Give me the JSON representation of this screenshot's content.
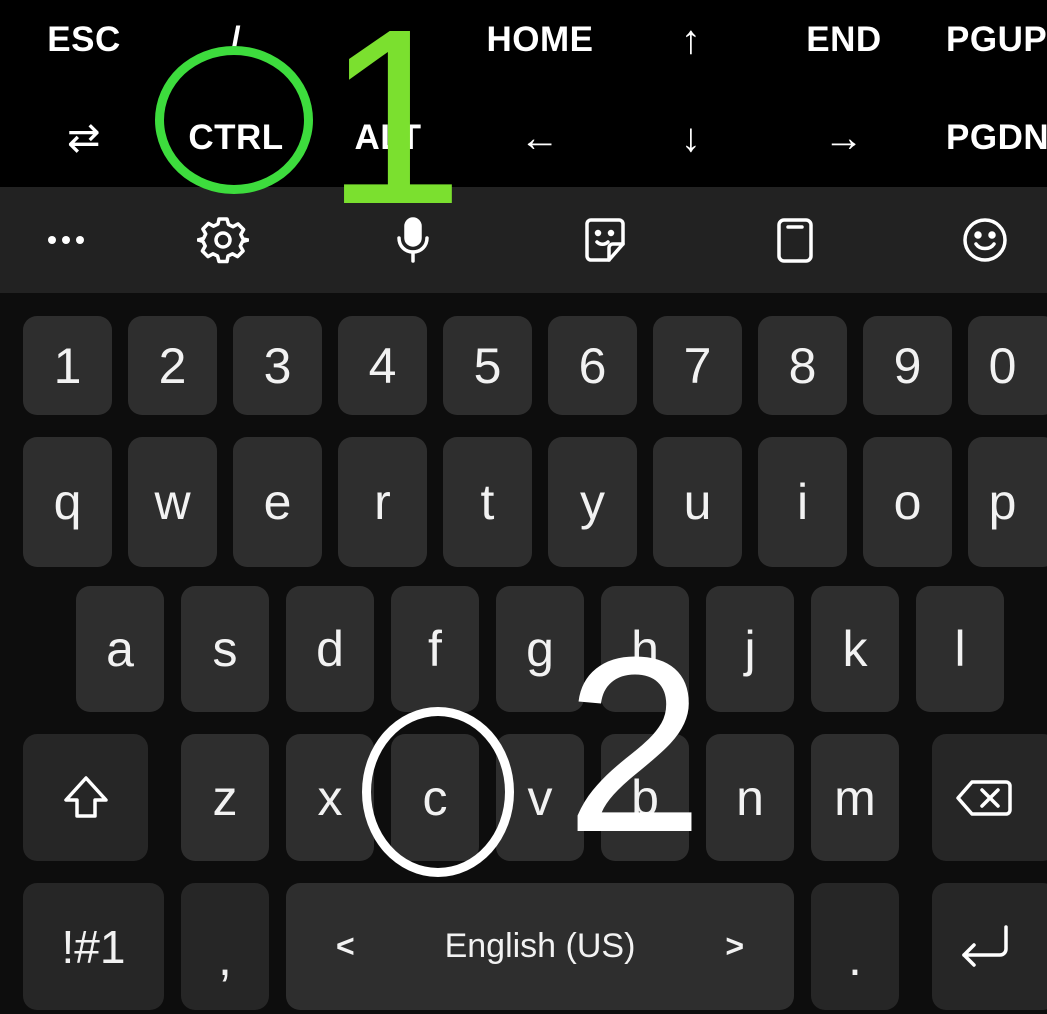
{
  "extra_keys": {
    "row1": [
      "ESC",
      "/",
      "-",
      "HOME",
      "↑",
      "END",
      "PGUP"
    ],
    "row2": [
      "⇄",
      "CTRL",
      "ALT",
      "←",
      "↓",
      "→",
      "PGDN"
    ]
  },
  "toolbar": {
    "icons": [
      "more-icon",
      "gear-icon",
      "microphone-icon",
      "sticker-icon",
      "clipboard-icon",
      "emoji-icon"
    ]
  },
  "keyboard": {
    "numbers": [
      "1",
      "2",
      "3",
      "4",
      "5",
      "6",
      "7",
      "8",
      "9",
      "0"
    ],
    "row_q": [
      "q",
      "w",
      "e",
      "r",
      "t",
      "y",
      "u",
      "i",
      "o",
      "p"
    ],
    "row_a": [
      "a",
      "s",
      "d",
      "f",
      "g",
      "h",
      "j",
      "k",
      "l"
    ],
    "row_z": [
      "z",
      "x",
      "c",
      "v",
      "b",
      "n",
      "m"
    ],
    "symbols_label": "!#1",
    "comma_label": ",",
    "space_language": "English (US)",
    "left_chevron": "<",
    "right_chevron": ">",
    "period_label": "."
  },
  "annotations": {
    "step1": "1",
    "step2": "2",
    "step1_color": "#3ddc3d",
    "step2_color": "#ffffff"
  }
}
